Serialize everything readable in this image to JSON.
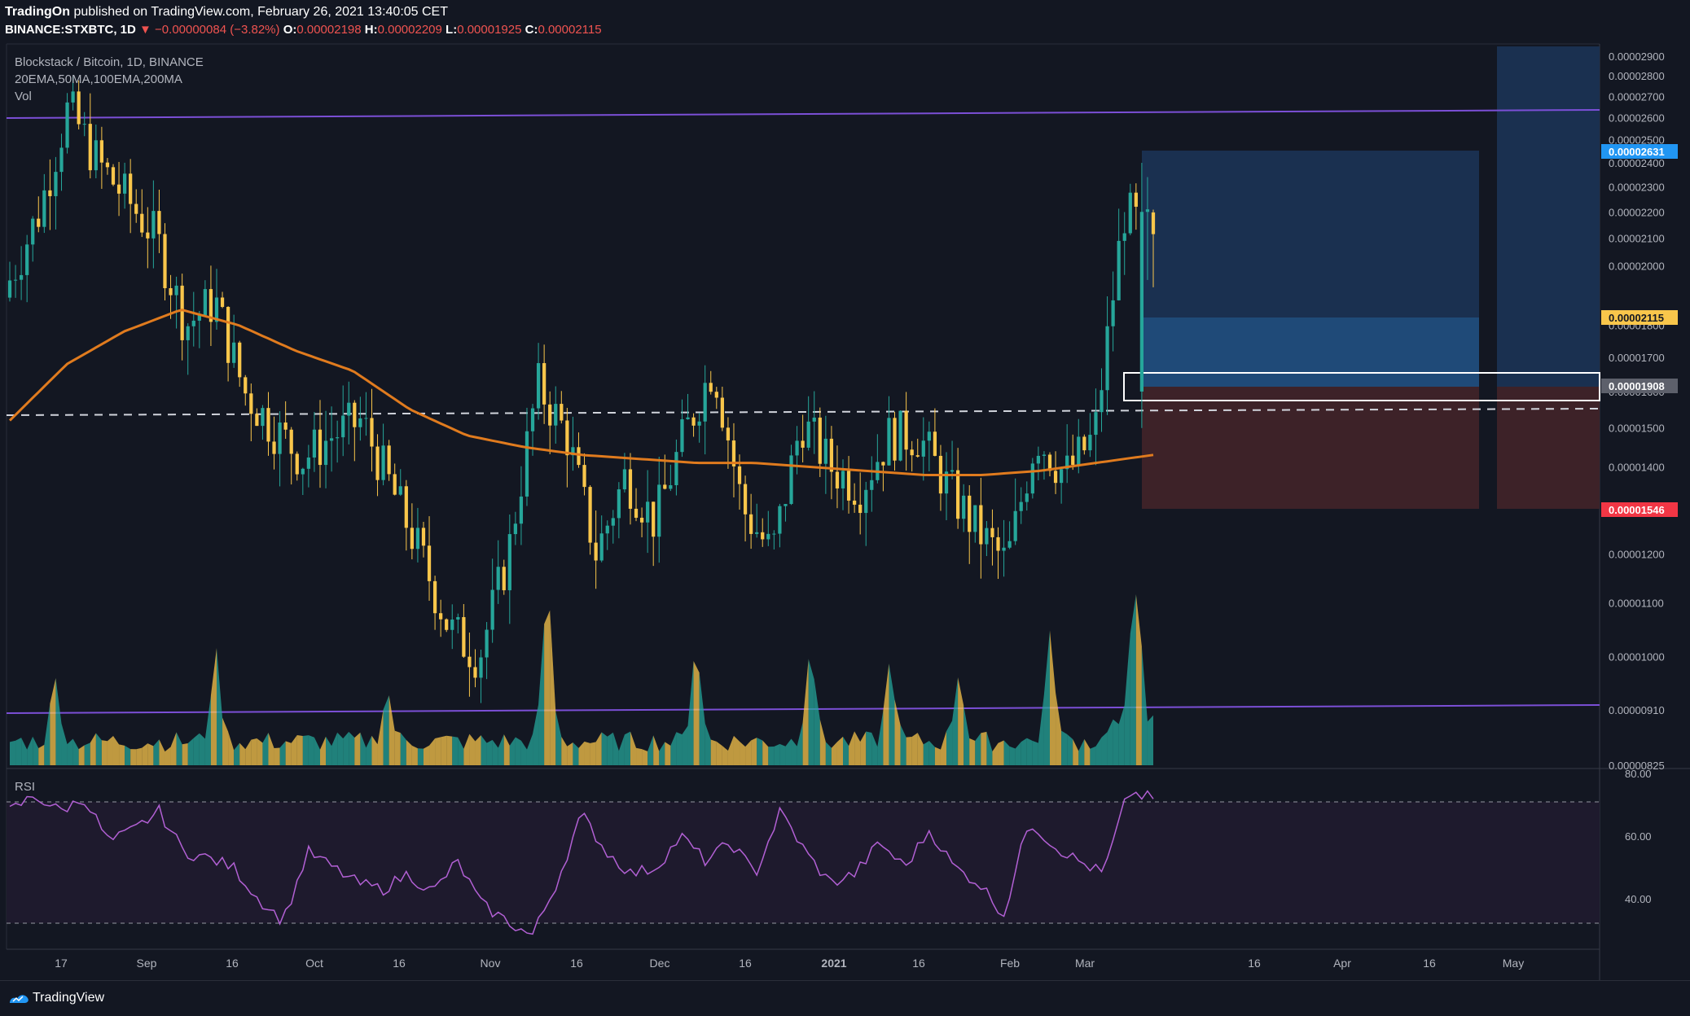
{
  "header": {
    "publisher": "TradingOn",
    "published_text": "published on TradingView.com, February 26, 2021 13:40:05 CET",
    "symbol": "BINANCE:STXBTC, 1D",
    "change_arrow": "▼",
    "change": "−0.00000084 (−3.82%)",
    "o_label": "O:",
    "o_value": "0.00002198",
    "h_label": "H:",
    "h_value": "0.00002209",
    "l_label": "L:",
    "l_value": "0.00001925",
    "c_label": "C:",
    "c_value": "0.00002115"
  },
  "legend": {
    "title": "Blockstack / Bitcoin, 1D, BINANCE",
    "indicators": "20EMA,50MA,100EMA,200MA",
    "volume": "Vol",
    "rsi": "RSI"
  },
  "footer": {
    "brand": "TradingView"
  },
  "colors": {
    "background": "#131722",
    "bull": "#26a69a",
    "bear": "#f9c64b",
    "ema": "#e07b1e",
    "support_resistance": "#7b4fd6",
    "rsi_line": "#b260d4",
    "target_zone": "#1e3a5f",
    "stop_zone": "#4a2428",
    "entry_tag": "#5d606b",
    "target_tag": "#2196f3",
    "stop_tag": "#f23645",
    "last_price_tag": "#f9c64b"
  },
  "chart_data": [
    {
      "type": "candlestick",
      "title": "Blockstack / Bitcoin, 1D, BINANCE",
      "x_tick_labels": [
        "17",
        "Sep",
        "16",
        "Oct",
        "16",
        "Nov",
        "16",
        "Dec",
        "16",
        "2021",
        "16",
        "Feb",
        "Mar",
        "16",
        "Apr",
        "16",
        "May"
      ],
      "y_tick_labels": [
        "0.00002900",
        "0.00002800",
        "0.00002700",
        "0.00002600",
        "0.00002500",
        "0.00002400",
        "0.00002300",
        "0.00002200",
        "0.00002100",
        "0.00002000",
        "0.00001800",
        "0.00001700",
        "0.00001600",
        "0.00001500",
        "0.00001400",
        "0.00001300",
        "0.00001200",
        "0.00001100",
        "0.00001000",
        "0.00000910",
        "0.00000825"
      ],
      "y_scale": "log",
      "ylim": [
        8.25e-06,
        2.95e-05
      ],
      "price_tags": {
        "target": "0.00002631",
        "last": "0.00002115",
        "entry": "0.00001908",
        "stop": "0.00001546"
      },
      "levels": {
        "upper_trendline": 2.75e-05,
        "lower_trendline": 9.85e-06,
        "dashed_support": 1.83e-05
      },
      "candles_approx": {
        "period": "2020-08-10 to 2021-02-26, daily",
        "closes": [
          1.95e-05,
          2.2e-05,
          2.65e-05,
          2.4e-05,
          2.25e-05,
          2.1e-05,
          1.8e-05,
          1.88e-05,
          1.6e-05,
          1.5e-05,
          1.42e-05,
          1.48e-05,
          1.52e-05,
          1.35e-05,
          1.2e-05,
          1.05e-05,
          1e-05,
          1.2e-05,
          1.62e-05,
          1.48e-05,
          1.2e-05,
          1.38e-05,
          1.27e-05,
          1.48e-05,
          1.68e-05,
          1.3e-05,
          1.2e-05,
          1.52e-05,
          1.4e-05,
          1.35e-05,
          1.48e-05,
          1.48e-05,
          1.35e-05,
          1.25e-05,
          1.18e-05,
          1.48e-05,
          1.38e-05,
          1.48e-05,
          2.2e-05,
          2.115e-05
        ],
        "ema100": [
          1.52e-05,
          1.68e-05,
          1.78e-05,
          1.85e-05,
          1.8e-05,
          1.72e-05,
          1.66e-05,
          1.55e-05,
          1.48e-05,
          1.45e-05,
          1.43e-05,
          1.42e-05,
          1.41e-05,
          1.41e-05,
          1.4e-05,
          1.39e-05,
          1.38e-05,
          1.38e-05,
          1.39e-05,
          1.41e-05,
          1.43e-05
        ]
      }
    },
    {
      "type": "area",
      "title": "Vol",
      "note": "volume histogram, peaks near Aug 17, Sep 9, Nov 10, Dec 9, Dec 27, Jan 12, Feb 7, Feb 21"
    },
    {
      "type": "line",
      "title": "RSI",
      "y_tick_labels": [
        "80.00",
        "60.00",
        "40.00"
      ],
      "ylim": [
        25,
        80
      ],
      "bands": [
        70,
        30
      ],
      "values": [
        68,
        73,
        68,
        72,
        58,
        62,
        68,
        55,
        53,
        50,
        40,
        33,
        55,
        50,
        45,
        43,
        48,
        42,
        52,
        38,
        33,
        28,
        45,
        67,
        55,
        48,
        50,
        60,
        52,
        58,
        48,
        68,
        55,
        45,
        48,
        58,
        50,
        62,
        50,
        45,
        35,
        65,
        57,
        52,
        48,
        74,
        72
      ]
    }
  ]
}
